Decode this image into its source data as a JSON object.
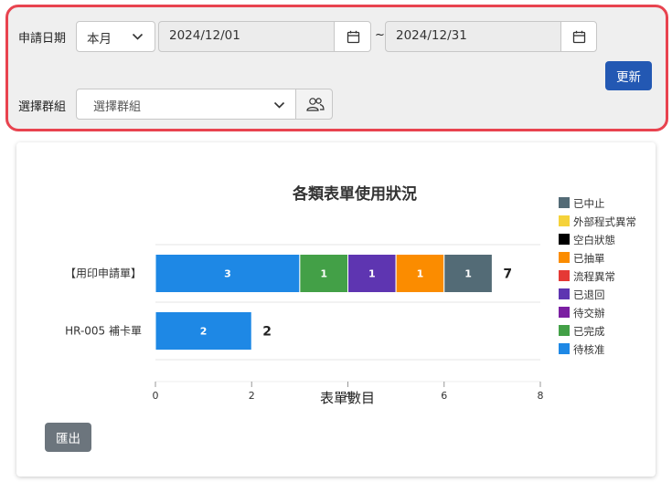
{
  "filter": {
    "date_label": "申請日期",
    "period_value": "本月",
    "start_date": "2024/12/01",
    "range_separator": "~",
    "end_date": "2024/12/31",
    "update_label": "更新",
    "group_label": "選擇群組",
    "group_placeholder": "選擇群組"
  },
  "export_label": "匯出",
  "colors": {
    "panel_border": "#e8434f",
    "update_button": "#2358b3",
    "export_button": "#6c757d"
  },
  "chart_data": {
    "type": "bar",
    "orientation": "horizontal",
    "stacked": true,
    "title": "各類表單使用狀況",
    "xlabel": "表單數目",
    "ylabel": "",
    "xlim": [
      0,
      8
    ],
    "x_ticks": [
      "0",
      "2",
      "4",
      "6",
      "8"
    ],
    "categories": [
      "【用印申請單】",
      "HR-005 補卡單"
    ],
    "totals": [
      "7",
      "2"
    ],
    "legend_position": "right",
    "series": [
      {
        "name": "已中止",
        "color": "#536b76",
        "values": [
          1,
          0
        ]
      },
      {
        "name": "外部程式異常",
        "color": "#f5d23a",
        "values": [
          0,
          0
        ]
      },
      {
        "name": "空白狀態",
        "color": "#000000",
        "values": [
          0,
          0
        ]
      },
      {
        "name": "已抽單",
        "color": "#fb8c00",
        "values": [
          1,
          0
        ]
      },
      {
        "name": "流程異常",
        "color": "#e53935",
        "values": [
          0,
          0
        ]
      },
      {
        "name": "已退回",
        "color": "#5e35b1",
        "values": [
          1,
          0
        ]
      },
      {
        "name": "待交辦",
        "color": "#7b1fa2",
        "values": [
          0,
          0
        ]
      },
      {
        "name": "已完成",
        "color": "#43a047",
        "values": [
          1,
          0
        ]
      },
      {
        "name": "待核准",
        "color": "#1e88e5",
        "values": [
          3,
          2
        ]
      }
    ]
  }
}
